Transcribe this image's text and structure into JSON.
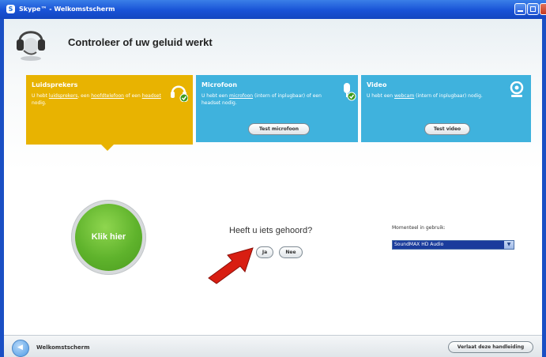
{
  "window": {
    "title": "Skype™ - Welkomstscherm",
    "app_icon": "S"
  },
  "header": {
    "title": "Controleer of uw geluid werkt"
  },
  "panels": {
    "speakers": {
      "title": "Luidsprekers",
      "desc_1": "U hebt ",
      "link_1": "luidsprekers",
      "desc_2": ", een ",
      "link_2": "hoofdtelefoon",
      "desc_3": " of een ",
      "link_3": "headset",
      "desc_4": " nodig."
    },
    "mic": {
      "title": "Microfoon",
      "desc_1": "U hebt een ",
      "link_1": "microfoon",
      "desc_2": " (intern of inplugbaar) of een headset nodig.",
      "button": "Test microfoon"
    },
    "video": {
      "title": "Video",
      "desc_1": "U hebt een ",
      "link_1": "webcam",
      "desc_2": " (intern of inplugbaar) nodig.",
      "button": "Test video"
    }
  },
  "main": {
    "big_button": "Klik hier",
    "question": "Heeft u iets gehoord?",
    "yes_button": "Ja",
    "no_button": "Nee",
    "device_label": "Momenteel in gebruik:",
    "device_value": "SoundMAX HD Audio"
  },
  "footer": {
    "label": "Welkomstscherm",
    "exit_button": "Verlaat deze handleiding"
  },
  "colors": {
    "titlebar": "#1852d6",
    "speakers_panel": "#e8b301",
    "blue_panel": "#3fb2dd",
    "big_button": "#5fb32c",
    "arrow": "#d81e12"
  },
  "icons": [
    "headset-icon",
    "headphones-icon",
    "microphone-icon",
    "webcam-icon",
    "check-icon",
    "back-arrow-icon",
    "chevron-down-icon"
  ]
}
